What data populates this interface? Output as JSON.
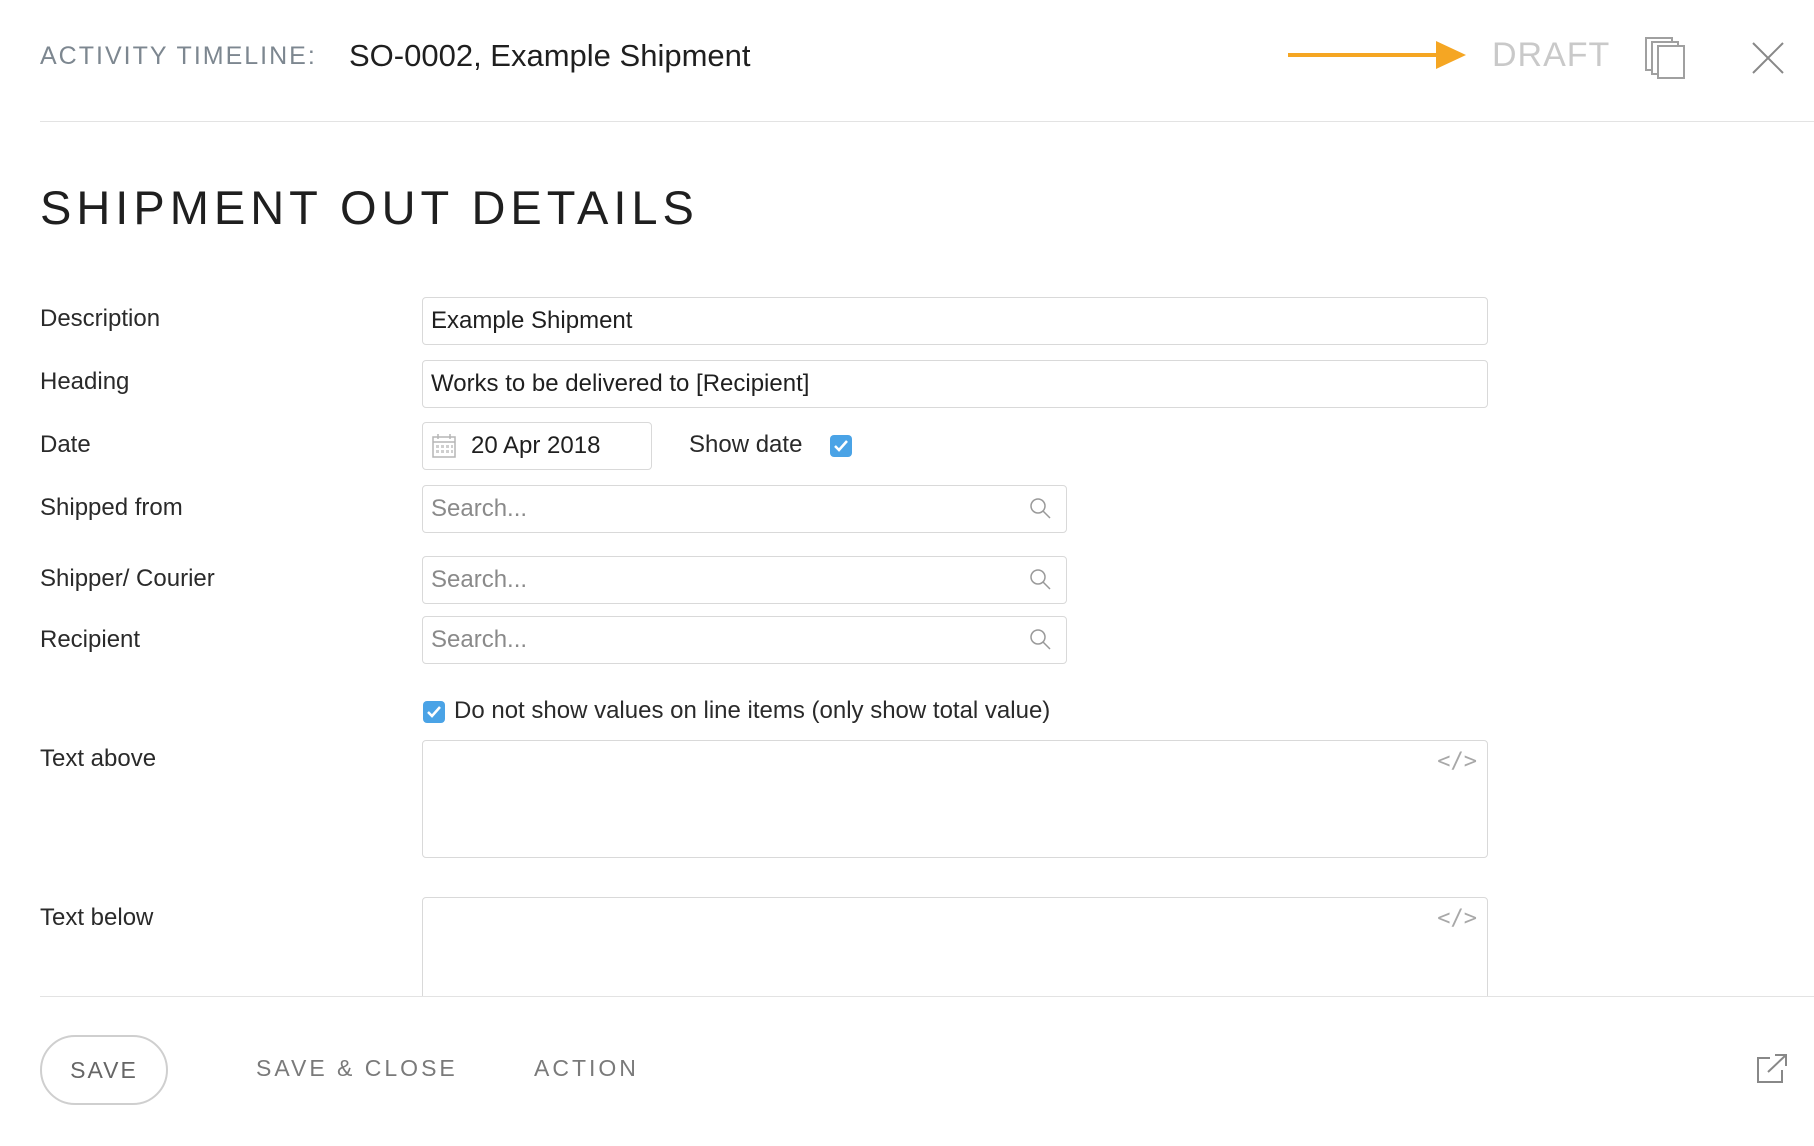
{
  "header": {
    "label": "ACTIVITY TIMELINE:",
    "title": "SO-0002, Example Shipment",
    "status": "DRAFT",
    "arrow_color": "#F5A623",
    "icons": [
      "copy-icon",
      "close-icon"
    ]
  },
  "section": {
    "title": "SHIPMENT OUT DETAILS"
  },
  "form": {
    "description": {
      "label": "Description",
      "value": "Example Shipment"
    },
    "heading": {
      "label": "Heading",
      "value": "Works to be delivered to [Recipient]"
    },
    "date": {
      "label": "Date",
      "value": "20 Apr 2018",
      "show_date_label": "Show date",
      "show_date_checked": true
    },
    "shipped_from": {
      "label": "Shipped from",
      "placeholder": "Search..."
    },
    "shipper": {
      "label": "Shipper/ Courier",
      "placeholder": "Search..."
    },
    "recipient": {
      "label": "Recipient",
      "placeholder": "Search..."
    },
    "hide_values": {
      "label": "Do not show values on line items (only show total value)",
      "checked": true
    },
    "text_above": {
      "label": "Text above",
      "value": ""
    },
    "text_below": {
      "label": "Text below",
      "value": ""
    },
    "code_icon": "</>"
  },
  "footer": {
    "save_label": "SAVE",
    "save_close_label": "SAVE & CLOSE",
    "action_label": "ACTION",
    "icons": [
      "external-link-icon"
    ]
  },
  "colors": {
    "accent": "#4AA3E6",
    "status": "#C9C9C9"
  }
}
